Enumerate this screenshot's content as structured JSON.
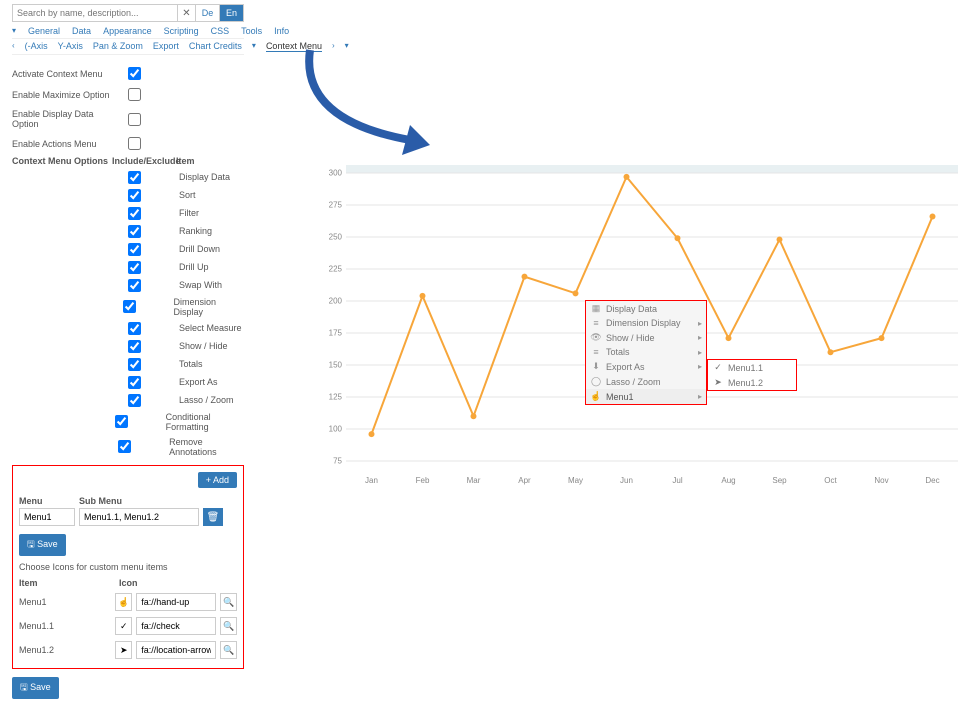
{
  "search": {
    "placeholder": "Search by name, description..."
  },
  "lang": {
    "de": "De",
    "en": "En"
  },
  "tabs1": [
    "General",
    "Data",
    "Appearance",
    "Scripting",
    "CSS",
    "Tools",
    "Info"
  ],
  "tabs2": {
    "items": [
      "(-Axis",
      "Y-Axis",
      "Pan & Zoom",
      "Export",
      "Chart Credits",
      "Context Menu"
    ]
  },
  "settings": {
    "activate": "Activate Context Menu",
    "maximize": "Enable Maximize Option",
    "display_data_opt": "Enable Display Data Option",
    "actions": "Enable Actions Menu",
    "options_label": "Context Menu Options",
    "col_include": "Include/Exclude",
    "col_item": "Item",
    "items": [
      "Display Data",
      "Sort",
      "Filter",
      "Ranking",
      "Drill Down",
      "Drill Up",
      "Swap With",
      "Dimension Display",
      "Select Measure",
      "Show / Hide",
      "Totals",
      "Export As",
      "Lasso / Zoom",
      "Conditional Formatting",
      "Remove Annotations"
    ]
  },
  "custom": {
    "add": "+ Add",
    "menu_hdr": "Menu",
    "sub_hdr": "Sub Menu",
    "menu_val": "Menu1",
    "sub_val": "Menu1.1, Menu1.2",
    "save": "Save",
    "icons_title": "Choose Icons for custom menu items",
    "item_hdr": "Item",
    "icon_hdr": "Icon",
    "rows": [
      {
        "label": "Menu1",
        "glyph": "☝",
        "val": "fa://hand-up"
      },
      {
        "label": "Menu1.1",
        "glyph": "✓",
        "val": "fa://check"
      },
      {
        "label": "Menu1.2",
        "glyph": "➤",
        "val": "fa://location-arrow"
      }
    ]
  },
  "ctx": {
    "items": [
      {
        "icon": "▦",
        "label": "Display Data",
        "arrow": false
      },
      {
        "icon": "≡",
        "label": "Dimension Display",
        "arrow": true
      },
      {
        "icon": "👁",
        "label": "Show / Hide",
        "arrow": true
      },
      {
        "icon": "≡",
        "label": "Totals",
        "arrow": true
      },
      {
        "icon": "⬇",
        "label": "Export As",
        "arrow": true
      },
      {
        "icon": "◯",
        "label": "Lasso / Zoom",
        "arrow": false
      },
      {
        "icon": "☝",
        "label": "Menu1",
        "arrow": true
      }
    ],
    "sub": [
      {
        "icon": "✓",
        "label": "Menu1.1"
      },
      {
        "icon": "➤",
        "label": "Menu1.2"
      }
    ]
  },
  "chart_data": {
    "type": "line",
    "categories": [
      "Jan",
      "Feb",
      "Mar",
      "Apr",
      "May",
      "Jun",
      "Jul",
      "Aug",
      "Sep",
      "Oct",
      "Nov",
      "Dec"
    ],
    "values": [
      96,
      204,
      110,
      219,
      206,
      297,
      249,
      171,
      248,
      160,
      171,
      266
    ],
    "ylim": [
      75,
      300
    ],
    "yticks": [
      75,
      100,
      125,
      150,
      175,
      200,
      225,
      250,
      275,
      300
    ]
  }
}
